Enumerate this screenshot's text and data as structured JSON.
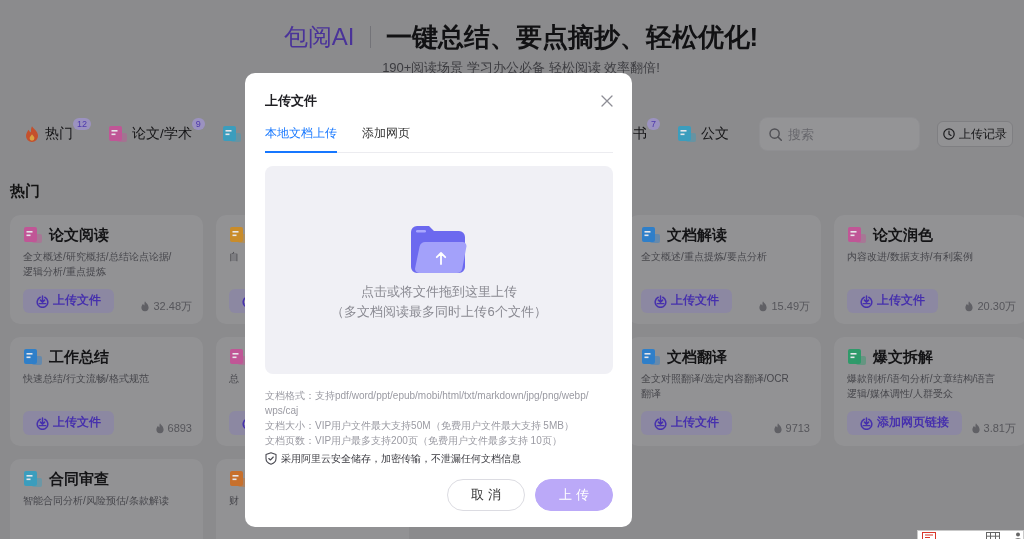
{
  "header": {
    "logo": "包阅AI",
    "headline": "一键总结、要点摘抄、轻松优化!",
    "subtitle": "190+阅读场景 学习办公必备 轻松阅读 效率翻倍!"
  },
  "category_tabs": [
    {
      "kind": "hot",
      "label": "热门",
      "badge": "12"
    },
    {
      "kind": "doc",
      "color": "#c05696",
      "label": "论文/学术",
      "badge": "9"
    },
    {
      "kind": "doc",
      "color": "#3b9dbd"
    },
    {
      "kind": "text",
      "label": "书",
      "badge": "7"
    },
    {
      "kind": "doc",
      "color": "#3b9dbd",
      "label": "公文"
    }
  ],
  "search": {
    "placeholder": "搜索"
  },
  "history_button": "上传记录",
  "section": {
    "title": "热门",
    "card_rows": [
      [
        {
          "color": "#c05696",
          "title": "论文阅读",
          "desc": "全文概述/研究概括/总结论点论据/逻辑分析/重点提炼",
          "button": {
            "kind": "upload",
            "label": "上传文件"
          },
          "count": "32.48万"
        },
        {
          "color": "#c98c2a",
          "desc": "自",
          "button": {
            "kind": "upload"
          }
        },
        {
          "color": "#2f7fc9",
          "title": "文档解读",
          "desc": "全文概述/重点提炼/要点分析",
          "button": {
            "kind": "upload",
            "label": "上传文件"
          },
          "count": "15.49万"
        },
        {
          "color": "#c05696",
          "title": "论文润色",
          "desc": "内容改进/数据支持/有利案例",
          "button": {
            "kind": "upload",
            "label": "上传文件"
          },
          "count": "20.30万"
        }
      ],
      [
        {
          "color": "#2f7fc9",
          "title": "工作总结",
          "desc": "快速总结/行文流畅/格式规范",
          "button": {
            "kind": "upload",
            "label": "上传文件"
          },
          "count": "6893"
        },
        {
          "color": "#c05696",
          "desc": "总",
          "button": {
            "kind": "upload"
          }
        },
        {
          "color": "#2f7fc9",
          "title": "文档翻译",
          "desc": "全文对照翻译/选定内容翻译/OCR翻译",
          "button": {
            "kind": "upload",
            "label": "上传文件"
          },
          "count": "9713"
        },
        {
          "color": "#2f9a6a",
          "title": "爆文拆解",
          "desc": "爆款剖析/语句分析/文章结构/语言逻辑/媒体调性/人群受众",
          "button": {
            "kind": "upload",
            "label": "添加网页链接"
          },
          "count": "3.81万"
        }
      ],
      [
        {
          "color": "#3b9dbd",
          "title": "合同审查",
          "desc": "智能合同分析/风险预估/条款解读"
        },
        {
          "color": "#c7702c",
          "desc": "财"
        }
      ]
    ]
  },
  "upload_dialog": {
    "title": "上传文件",
    "tabs": [
      {
        "label": "本地文档上传",
        "selected": true
      },
      {
        "label": "添加网页",
        "selected": false
      }
    ],
    "drop_zone": {
      "prompt": "点击或将文件拖到这里上传",
      "note": "（多文档阅读最多同时上传6个文件）"
    },
    "info": [
      "文档格式：支持pdf/word/ppt/epub/mobi/html/txt/markdown/jpg/png/webp/wps/caj",
      "文档大小：VIP用户文件最大支持50M（免费用户文件最大支持 5MB）",
      "文档页数：VIP用户最多支持200页（免费用户文件最多支持 10页）"
    ],
    "security_note": "采用阿里云安全储存，加密传输，不泄漏任何文档信息",
    "buttons": [
      {
        "kind": "secondary",
        "label": "取 消",
        "disabled": false
      },
      {
        "kind": "primary",
        "label": "上 传",
        "disabled": true
      }
    ]
  }
}
